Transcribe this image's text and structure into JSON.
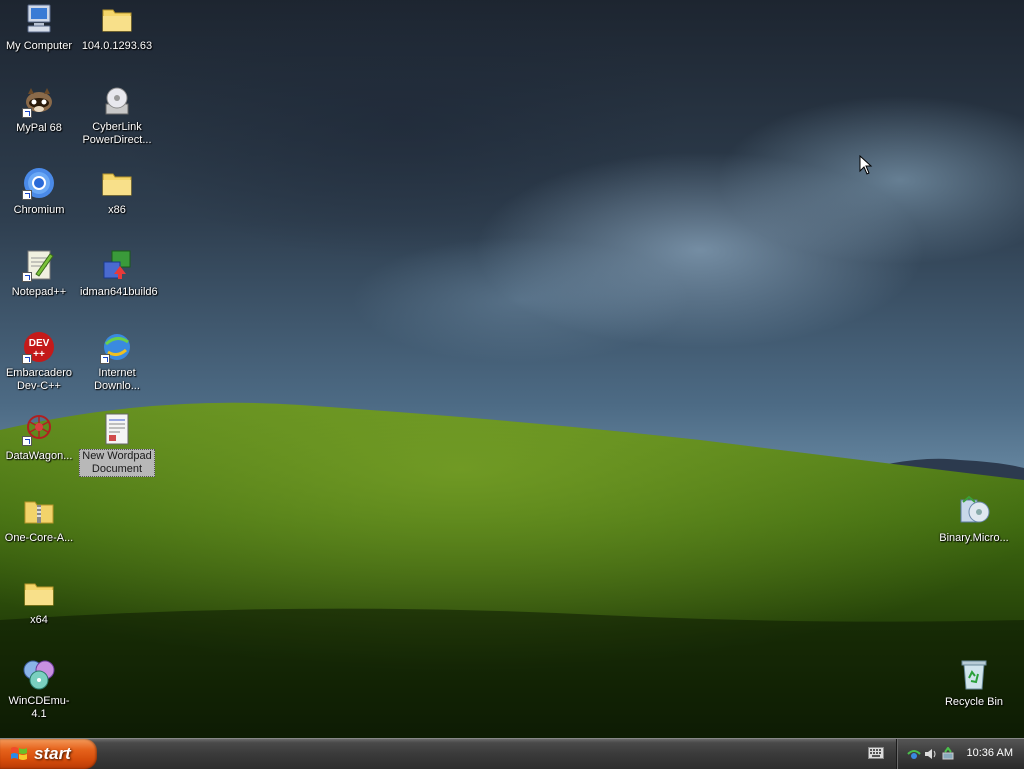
{
  "desktop": {
    "icons": [
      {
        "label": "My Computer",
        "icon": "my-computer-icon"
      },
      {
        "label": "104.0.1293.63",
        "icon": "folder-icon"
      },
      {
        "label": "MyPal 68",
        "icon": "mypal-raccoon-icon"
      },
      {
        "label": "CyberLink\nPowerDirect...",
        "icon": "cyberlink-disc-icon"
      },
      {
        "label": "Chromium",
        "icon": "chromium-icon"
      },
      {
        "label": "x86",
        "icon": "folder-icon"
      },
      {
        "label": "Notepad++",
        "icon": "notepad-plus-plus-icon"
      },
      {
        "label": "idman641build6",
        "icon": "installer-icon"
      },
      {
        "label": "Embarcadero\nDev-C++",
        "icon": "dev-cpp-icon"
      },
      {
        "label": "Internet\nDownlo...",
        "icon": "internet-download-manager-icon"
      },
      {
        "label": "DataWagon...",
        "icon": "datawagon-icon"
      },
      {
        "label": "New Wordpad\nDocument",
        "icon": "wordpad-document-icon"
      },
      {
        "label": "One-Core-A...",
        "icon": "zip-folder-icon"
      },
      {
        "label": "x64",
        "icon": "folder-icon"
      },
      {
        "label": "WinCDEmu-4.1",
        "icon": "wincdemu-discs-icon"
      },
      {
        "label": "Binary.Micro...",
        "icon": "recycle-disc-icon"
      },
      {
        "label": "Recycle Bin",
        "icon": "recycle-bin-icon"
      }
    ]
  },
  "taskbar": {
    "start_label": "start",
    "clock": "10:36 AM",
    "tray_icons": [
      "network-icon",
      "volume-icon",
      "safely-remove-icon"
    ],
    "language_bar_icon": "keyboard-icon"
  },
  "colors": {
    "start_button": "#d54c0b",
    "taskbar": "#3a3a3a",
    "selection": "#b8b8b8"
  }
}
